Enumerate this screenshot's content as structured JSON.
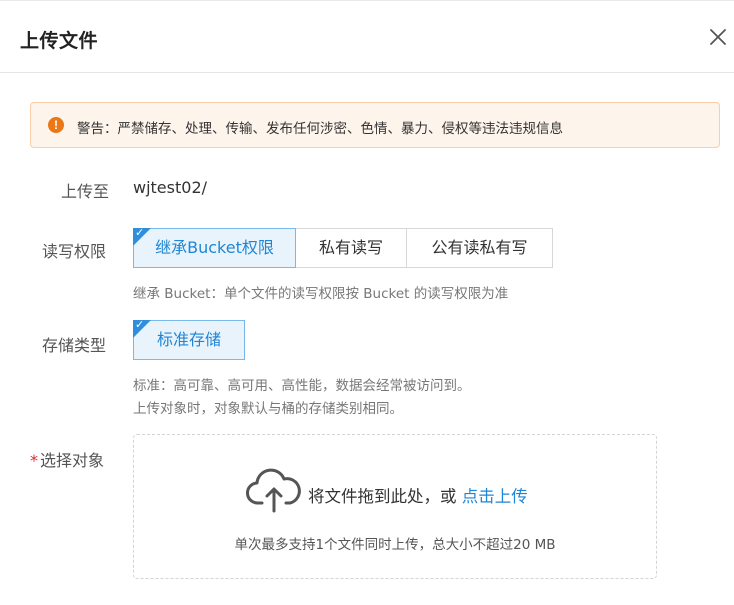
{
  "dialog": {
    "title": "上传文件",
    "close_icon": "close-icon"
  },
  "warning": {
    "icon": "exclamation-icon",
    "color": "#ea7816",
    "text": "警告：严禁储存、处理、传输、发布任何涉密、色情、暴力、侵权等违法违规信息"
  },
  "upload_to": {
    "label": "上传至",
    "value": "wjtest02/"
  },
  "acl": {
    "label": "读写权限",
    "options": [
      "继承Bucket权限",
      "私有读写",
      "公有读私有写"
    ],
    "selected": "继承Bucket权限",
    "hint": "继承 Bucket：单个文件的读写权限按 Bucket 的读写权限为准"
  },
  "storage": {
    "label": "存储类型",
    "options": [
      "标准存储"
    ],
    "selected": "标准存储",
    "hint_line1": "标准：高可靠、高可用、高性能，数据会经常被访问到。",
    "hint_line2": "上传对象时，对象默认与桶的存储类别相同。"
  },
  "select_object": {
    "required_mark": "*",
    "label": "选择对象",
    "drop_text": "将文件拖到此处，或",
    "click_upload": "点击上传",
    "sub_text": "单次最多支持1个文件同时上传，总大小不超过20 MB",
    "icon": "cloud-upload-icon"
  },
  "colors": {
    "accent": "#1f86d6",
    "selected_bg": "#e8f3fc",
    "warning_bg": "#fdf4ec",
    "required": "#d92b2b"
  }
}
